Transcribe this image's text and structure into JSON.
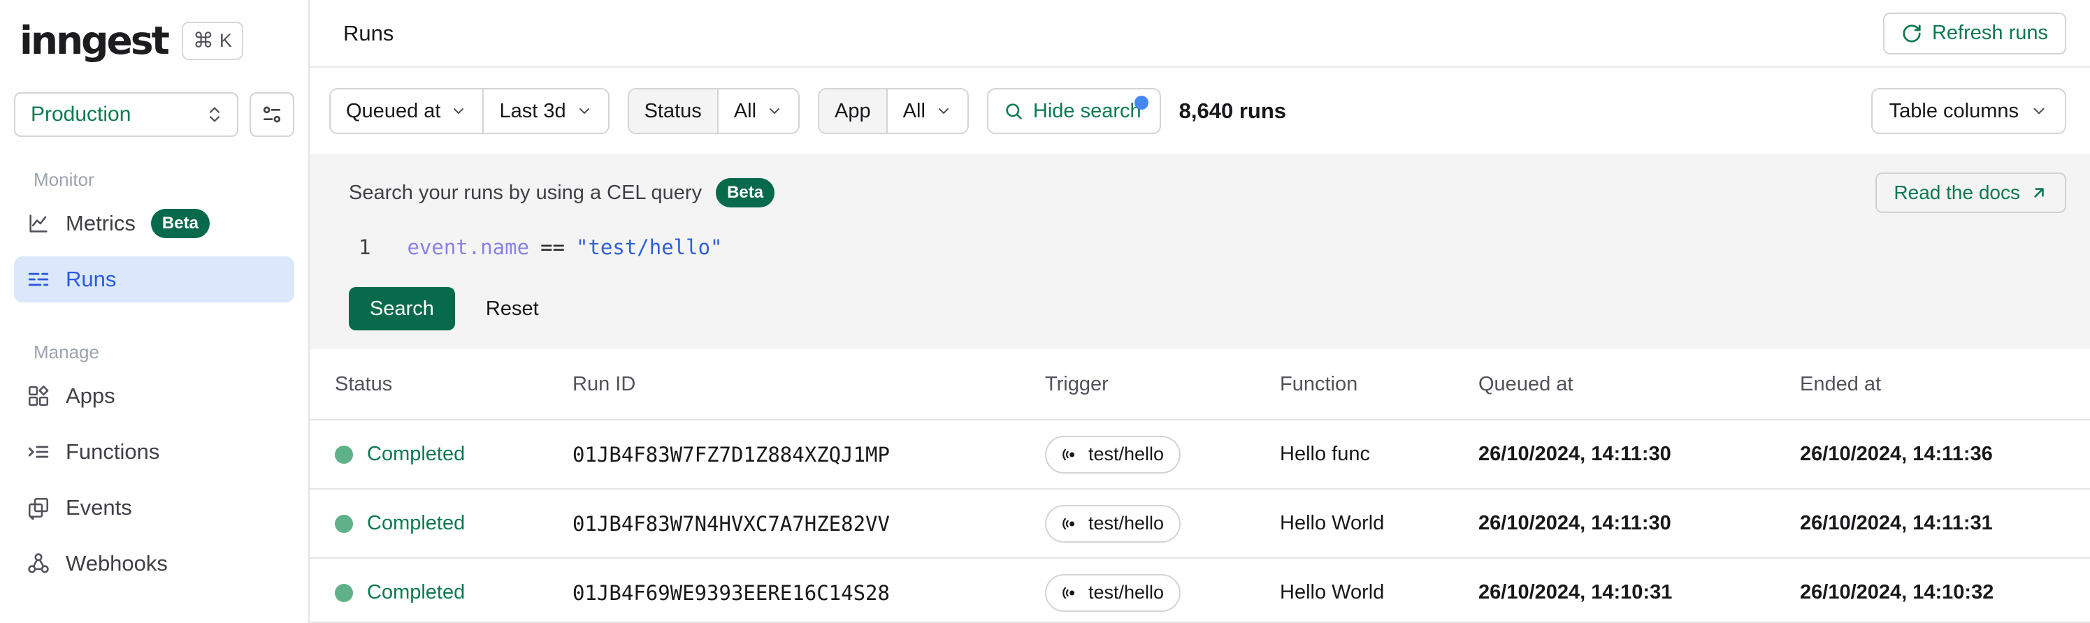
{
  "colors": {
    "accent_green": "#0c7a4e",
    "button_green": "#076a4a",
    "badge_green": "#076a4a",
    "active_blue": "#2a5ae0",
    "active_blue_bg": "#dbe8fb",
    "notification_blue": "#4688f1",
    "status_dot_green": "#5eb188",
    "code_property_purple": "#8a82e4",
    "code_string_blue": "#2e5fd8",
    "panel_gray_bg": "#f4f4f4"
  },
  "topbar": {
    "logo": "inngest",
    "shortcut_cmd": "⌘",
    "shortcut_key": "K"
  },
  "sidebar": {
    "environment": "Production",
    "monitor_label": "Monitor",
    "metrics_label": "Metrics",
    "metrics_badge": "Beta",
    "runs_label": "Runs",
    "manage_label": "Manage",
    "apps_label": "Apps",
    "functions_label": "Functions",
    "events_label": "Events",
    "webhooks_label": "Webhooks"
  },
  "header": {
    "title": "Runs",
    "refresh_label": "Refresh runs"
  },
  "filters": {
    "time_field": "Queued at",
    "time_range": "Last 3d",
    "status_label": "Status",
    "status_value": "All",
    "app_label": "App",
    "app_value": "All",
    "search_toggle": "Hide search",
    "runs_count": "8,640 runs",
    "table_columns": "Table columns"
  },
  "search_panel": {
    "title": "Search your runs by using a CEL query",
    "badge": "Beta",
    "docs_link": "Read the docs",
    "line_number": "1",
    "code": {
      "property": "event.name",
      "operator": "==",
      "value": "\"test/hello\""
    },
    "search_button": "Search",
    "reset_button": "Reset"
  },
  "table": {
    "columns": [
      "Status",
      "Run ID",
      "Trigger",
      "Function",
      "Queued at",
      "Ended at"
    ],
    "rows": [
      {
        "status": "Completed",
        "run_id": "01JB4F83W7FZ7D1Z884XZQJ1MP",
        "trigger": "test/hello",
        "function": "Hello func",
        "queued_at": "26/10/2024, 14:11:30",
        "ended_at": "26/10/2024, 14:11:36"
      },
      {
        "status": "Completed",
        "run_id": "01JB4F83W7N4HVXC7A7HZE82VV",
        "trigger": "test/hello",
        "function": "Hello World",
        "queued_at": "26/10/2024, 14:11:30",
        "ended_at": "26/10/2024, 14:11:31"
      },
      {
        "status": "Completed",
        "run_id": "01JB4F69WE9393EERE16C14S28",
        "trigger": "test/hello",
        "function": "Hello World",
        "queued_at": "26/10/2024, 14:10:31",
        "ended_at": "26/10/2024, 14:10:32"
      }
    ]
  }
}
